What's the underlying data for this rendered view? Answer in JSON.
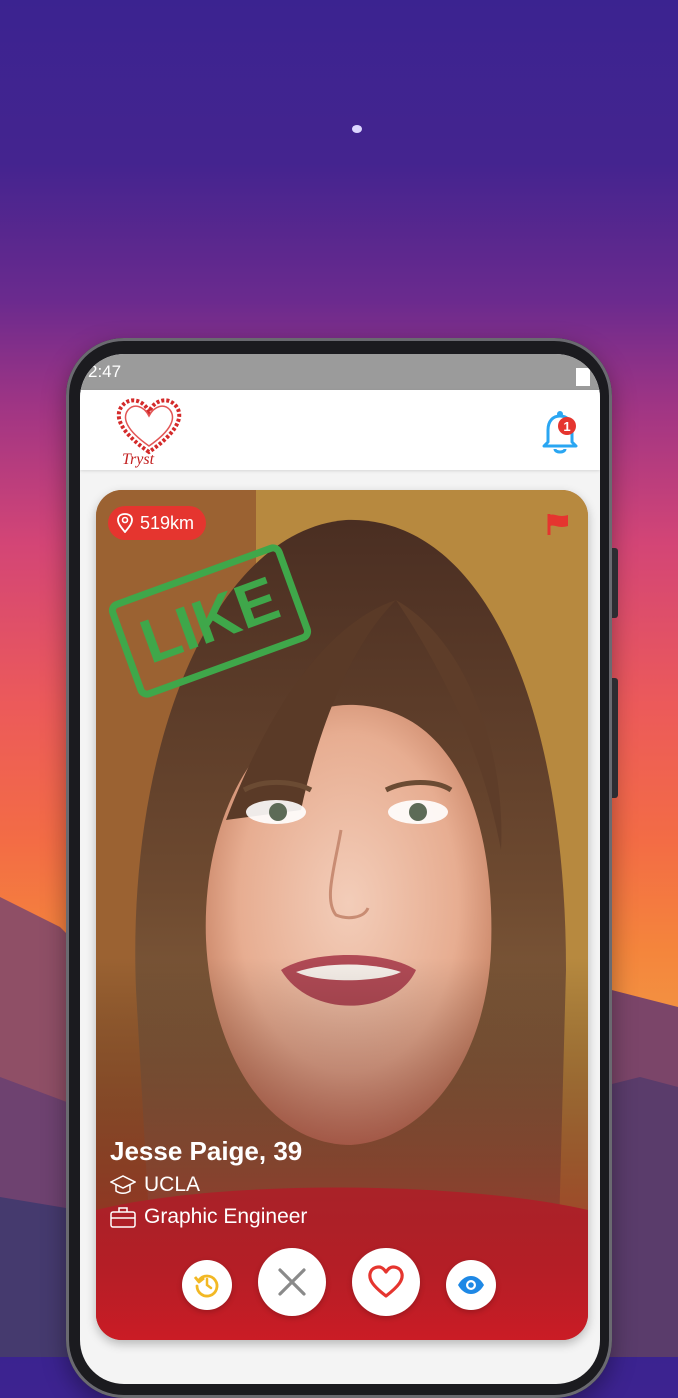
{
  "status_bar": {
    "time": "2:47"
  },
  "app": {
    "logo_text": "Tryst",
    "notification_count": "1"
  },
  "profile": {
    "distance": "519km",
    "stamp": "LIKE",
    "name_age": "Jesse Paige, 39",
    "school": "UCLA",
    "job": "Graphic Engineer"
  },
  "actions": {
    "rewind": "rewind-icon",
    "nope": "close-icon",
    "like": "heart-icon",
    "view": "eye-icon"
  },
  "colors": {
    "accent_red": "#e5352f",
    "like_green": "#3fa74a",
    "rewind_yellow": "#f2b824",
    "view_blue": "#1e88e5",
    "bell_blue": "#2aa6f2"
  }
}
